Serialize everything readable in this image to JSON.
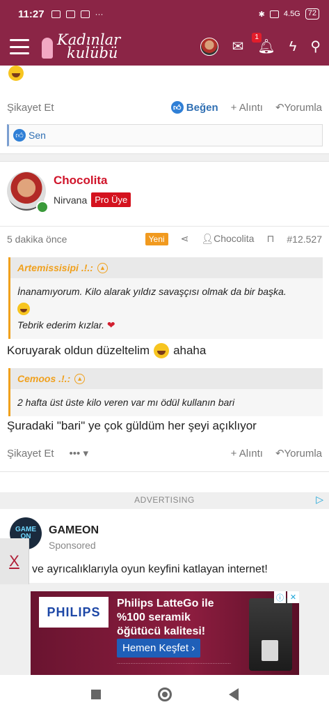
{
  "status_bar": {
    "time": "11:27",
    "dots": "···",
    "signal_label": "4.5G",
    "battery": "72"
  },
  "header": {
    "logo_line1": "Kadınlar",
    "logo_line2": "kulübü",
    "notification_count": "1"
  },
  "prev_post": {
    "report_label": "Şikayet Et",
    "like_label": "Beğen",
    "quote_label": "+ Alıntı",
    "reply_label": "Yorumla",
    "reaction_label": "Sen"
  },
  "post": {
    "author_name": "Chocolita",
    "author_rank": "Nirvana",
    "author_badge": "Pro Üye",
    "time_ago": "5 dakika önce",
    "new_badge": "Yeni",
    "author_ref": "Chocolita",
    "post_number": "#12.527",
    "quote1": {
      "author": "Artemissisipi .!.:",
      "line1": "İnanamıyorum. Kilo alarak yıldız savaşçısı olmak da bir başka.",
      "line2": "Tebrik ederim kızlar."
    },
    "text1": "Koruyarak oldun düzeltelim",
    "text1_after": "ahaha",
    "quote2": {
      "author": "Cemoos .!.:",
      "line1": "2 hafta üst üste kilo veren var mı ödül kullanın bari"
    },
    "text2": "Şuradaki \"bari\" ye çok güldüm her şeyi açıklıyor",
    "report_label": "Şikayet Et",
    "more_label": "•••",
    "quote_label": "+ Alıntı",
    "reply_label": "Yorumla"
  },
  "ad": {
    "label": "ADVERTISING",
    "brand": "GAMEON",
    "logo_text": "GAME ON",
    "sponsored": "Sponsored",
    "text": "ve ayrıcalıklarıyla oyun keyfini katlayan internet!",
    "close": "X",
    "banner_logo": "PHILIPS",
    "banner_title_1": "Philips LatteGo ile",
    "banner_title_2": "%100 seramik",
    "banner_title_3": "öğütücü kalitesi!",
    "banner_button": "Hemen Keşfet ›"
  },
  "colors": {
    "brand": "#8b2546",
    "accent": "#d0142a",
    "quote_accent": "#f0a01c",
    "link": "#2f6fb3"
  }
}
